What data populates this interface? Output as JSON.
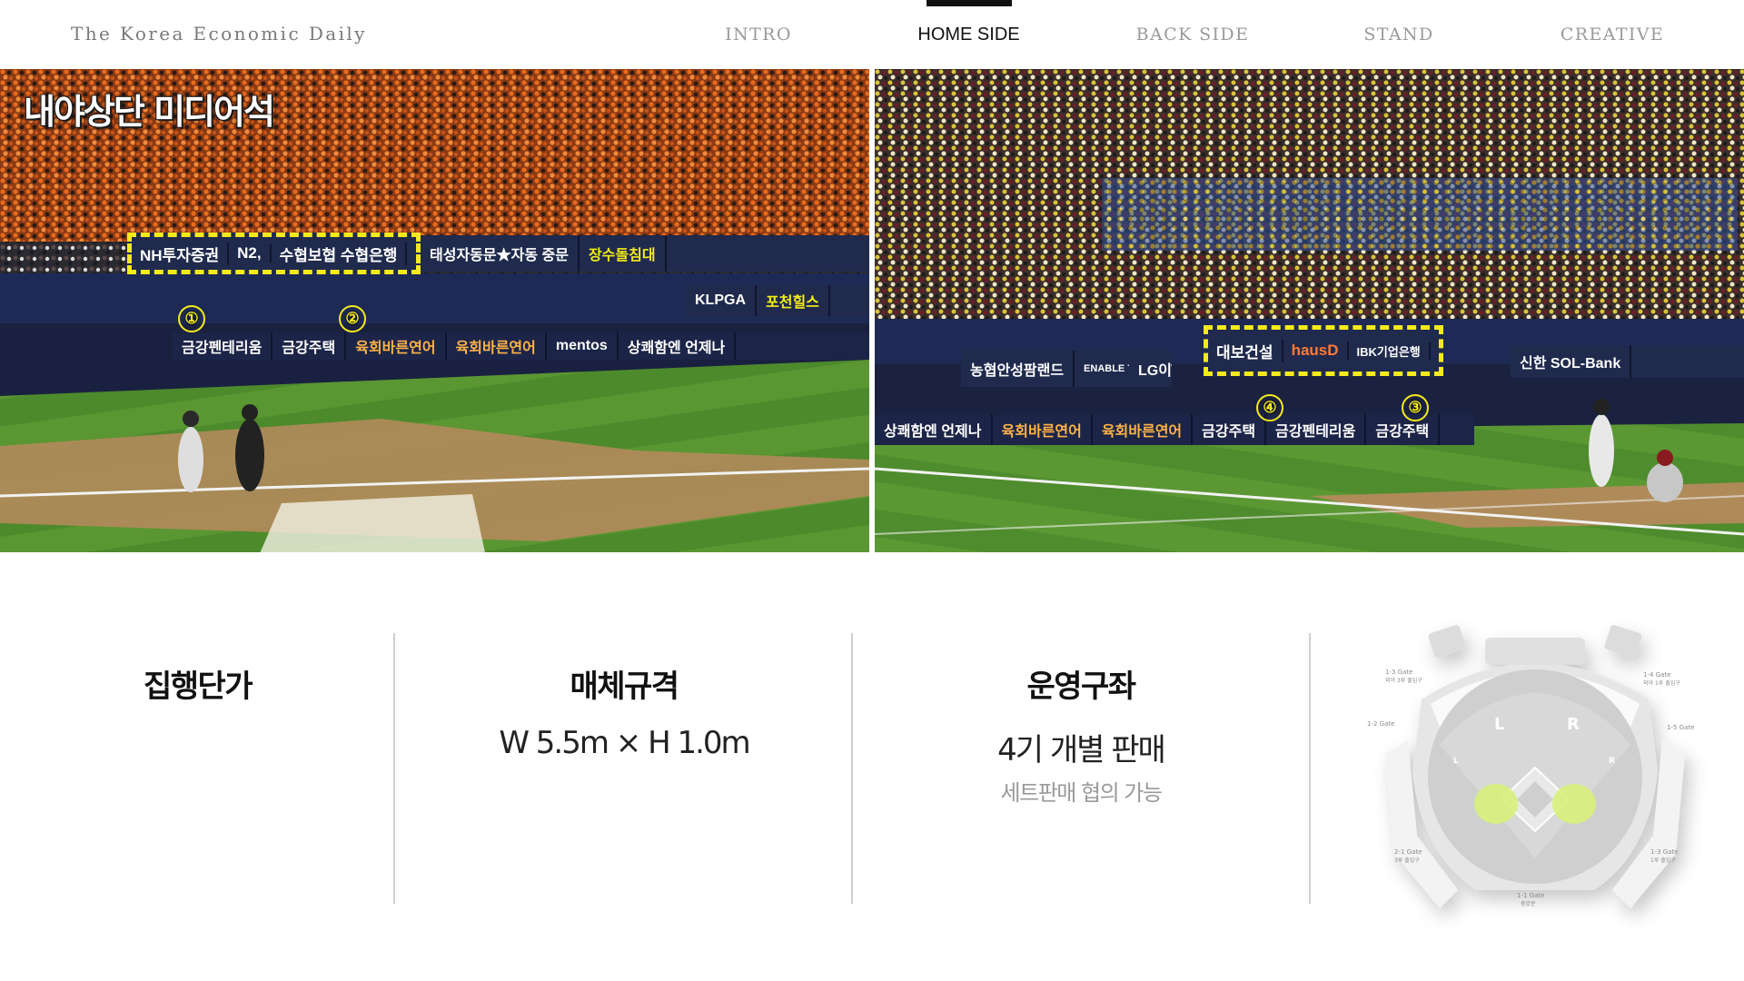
{
  "header": {
    "brand": "The Korea Economic Daily",
    "nav": [
      {
        "label": "INTRO",
        "active": false
      },
      {
        "label": "HOME SIDE",
        "active": true
      },
      {
        "label": "BACK SIDE",
        "active": false
      },
      {
        "label": "STAND",
        "active": false
      },
      {
        "label": "CREATIVE",
        "active": false
      }
    ]
  },
  "gallery": {
    "section_title": "내야상단 미디어석",
    "left_photo": {
      "ad_boards": [
        "NH투자증권",
        "N2,",
        "수협보협 수협은행"
      ],
      "other_boards": [
        "태성자동문★자동 중문",
        "장수돌침대",
        "KLPGA",
        "포천힐스"
      ],
      "lower_boards": [
        "금강펜테리움",
        "금강주택",
        "육회바른연어",
        "육회바른연어",
        "mentos",
        "상쾌함엔 언제나"
      ],
      "markers": [
        "①",
        "②"
      ]
    },
    "right_photo": {
      "ad_boards": [
        "대보건설",
        "hausD",
        "IBK기업은행",
        "IBK기업은행"
      ],
      "other_boards": [
        "농협안성팜랜드",
        "ENABLE THE NEXT",
        "LG이노텍",
        "신한 SOL-Bank"
      ],
      "lower_boards": [
        "상쾌함엔 언제나",
        "육회바른연어",
        "육회바른연어",
        "금강주택",
        "금강펜테리움",
        "금강주택"
      ],
      "markers": [
        "④",
        "③"
      ]
    },
    "colors": {
      "highlight": "#f5ea1a",
      "ad_board": "#1f2a4d",
      "field_green": "#4f8a2e",
      "dirt": "#b98a5e"
    }
  },
  "info": {
    "columns": [
      {
        "title": "집행단가",
        "value": "",
        "note": ""
      },
      {
        "title": "매체규격",
        "value": "W 5.5m × H 1.0m",
        "note": ""
      },
      {
        "title": "운영구좌",
        "value": "4기 개별 판매",
        "note": "세트판매 협의 가능"
      }
    ]
  },
  "stadium_map": {
    "sides": [
      "L",
      "R"
    ],
    "foul_marks": [
      "L",
      "R"
    ],
    "gates": [
      {
        "name": "1-3 Gate",
        "sub": "외야 3루 출입구"
      },
      {
        "name": "1-4 Gate",
        "sub": "외야 1루 출입구"
      },
      {
        "name": "1-2 Gate",
        "sub": ""
      },
      {
        "name": "1-5 Gate",
        "sub": ""
      },
      {
        "name": "2-1 Gate",
        "sub": "3루 출입구"
      },
      {
        "name": "1-3 Gate",
        "sub": "1루 출입구"
      },
      {
        "name": "1-1 Gate",
        "sub": "중앙문"
      }
    ],
    "highlight_color": "#d8ef7a"
  }
}
